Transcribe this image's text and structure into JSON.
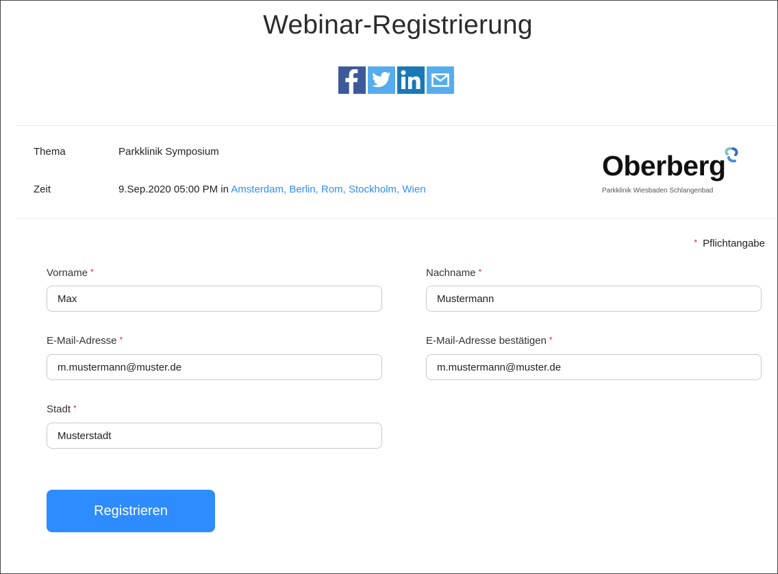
{
  "page_title": "Webinar-Registrierung",
  "share": {
    "facebook_icon": "facebook-icon",
    "twitter_icon": "twitter-icon",
    "linkedin_icon": "linkedin-icon",
    "email_icon": "email-icon"
  },
  "info": {
    "topic_label": "Thema",
    "topic_value": "Parkklinik Symposium",
    "time_label": "Zeit",
    "time_value": "9.Sep.2020 05:00 PM in",
    "timezone": "Amsterdam, Berlin, Rom, Stockholm, Wien"
  },
  "logo": {
    "word": "Oberberg",
    "subtitle": "Parkklinik Wiesbaden Schlangenbad"
  },
  "form": {
    "required_marker": "*",
    "required_note": "Pflichtangabe",
    "first_name": {
      "label": "Vorname",
      "value": "Max"
    },
    "last_name": {
      "label": "Nachname",
      "value": "Mustermann"
    },
    "email": {
      "label": "E-Mail-Adresse",
      "value": "m.mustermann@muster.de"
    },
    "email_confirm": {
      "label": "E-Mail-Adresse bestätigen",
      "value": "m.mustermann@muster.de"
    },
    "city": {
      "label": "Stadt",
      "value": "Musterstadt"
    },
    "submit_label": "Registrieren"
  },
  "colors": {
    "accent": "#2d8cff",
    "required": "#e02828",
    "facebook": "#3c5a9a",
    "twitter": "#55acee",
    "linkedin": "#1a78b8"
  }
}
